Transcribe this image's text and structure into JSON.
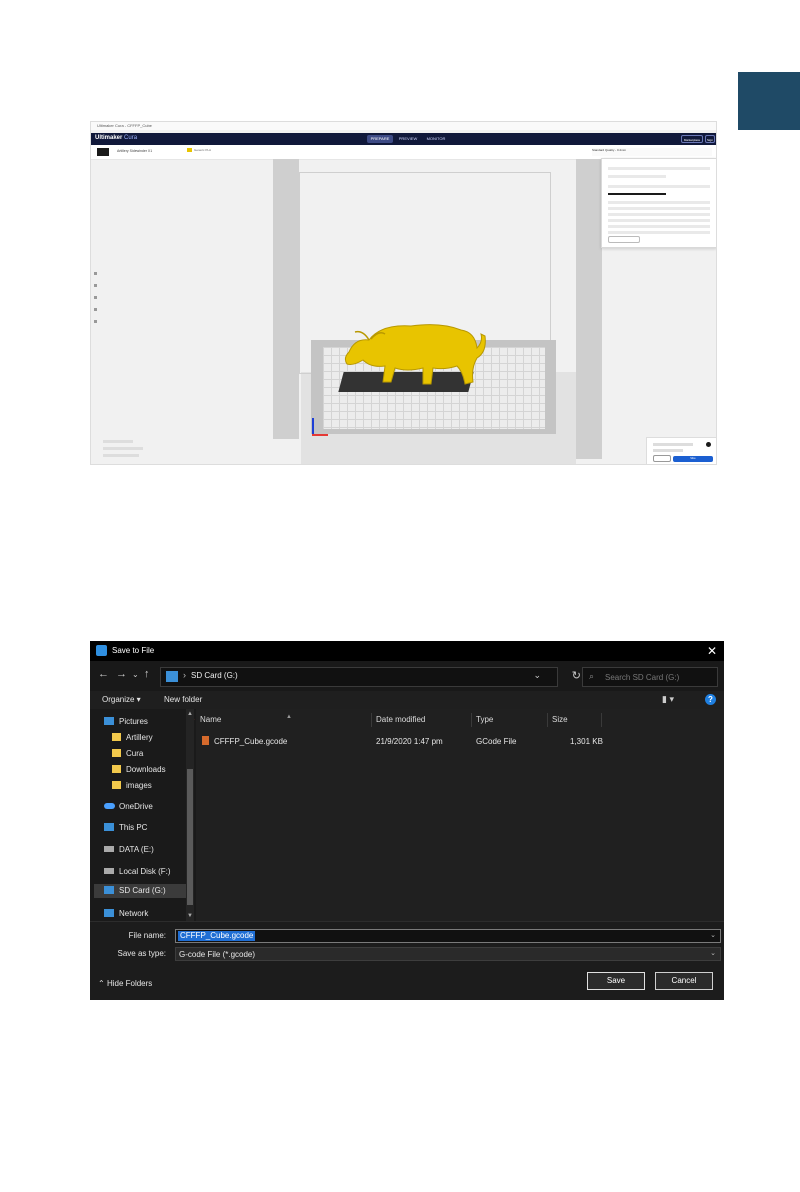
{
  "cura": {
    "window_title": "Ultimaker Cura - CFFFP_Cube",
    "sub_title": "",
    "logo_brand": "Ultimaker",
    "logo_product": "Cura",
    "stages": [
      "PREPARE",
      "PREVIEW",
      "MONITOR"
    ],
    "header_buttons": [
      "Marketplace",
      "Sign in"
    ],
    "printer_name": "Artillery Sidewinder X1",
    "material": "Generic PLA",
    "print_settings": "Standard Quality - 0.2mm",
    "slice_button": "Slice",
    "colors": {
      "header": "#10183a",
      "model": "#e8c400",
      "slice": "#1b5fd1"
    }
  },
  "dialog": {
    "title": "Save to File",
    "close_icon": "close-icon",
    "nav": {
      "back": "←",
      "forward": "→",
      "recent": "⌄",
      "up": "↑"
    },
    "address": {
      "separator": "›",
      "path": "SD Card (G:)"
    },
    "search_placeholder": "Search SD Card (G:)",
    "commands": {
      "organize": "Organize ▾",
      "new_folder": "New folder"
    },
    "sidebar": [
      {
        "label": "Pictures",
        "icon": "pictures-icon"
      },
      {
        "label": "Artillery",
        "icon": "folder-icon"
      },
      {
        "label": "Cura",
        "icon": "folder-icon"
      },
      {
        "label": "Downloads",
        "icon": "folder-icon"
      },
      {
        "label": "images",
        "icon": "folder-icon"
      },
      {
        "label": "OneDrive",
        "icon": "cloud-icon"
      },
      {
        "label": "This PC",
        "icon": "computer-icon"
      },
      {
        "label": "DATA (E:)",
        "icon": "drive-icon"
      },
      {
        "label": "Local Disk (F:)",
        "icon": "drive-icon"
      },
      {
        "label": "SD Card (G:)",
        "icon": "sd-card-icon"
      },
      {
        "label": "Network",
        "icon": "network-icon"
      }
    ],
    "columns": [
      "Name",
      "Date modified",
      "Type",
      "Size"
    ],
    "files": [
      {
        "name": "CFFFP_Cube.gcode",
        "date": "21/9/2020 1:47 pm",
        "type": "GCode File",
        "size": "1,301 KB"
      }
    ],
    "file_name_label": "File name:",
    "file_name_value": "CFFFP_Cube.gcode",
    "save_type_label": "Save as type:",
    "save_type_value": "G-code File (*.gcode)",
    "hide_folders": "Hide Folders",
    "save_label": "Save",
    "cancel_label": "Cancel"
  }
}
